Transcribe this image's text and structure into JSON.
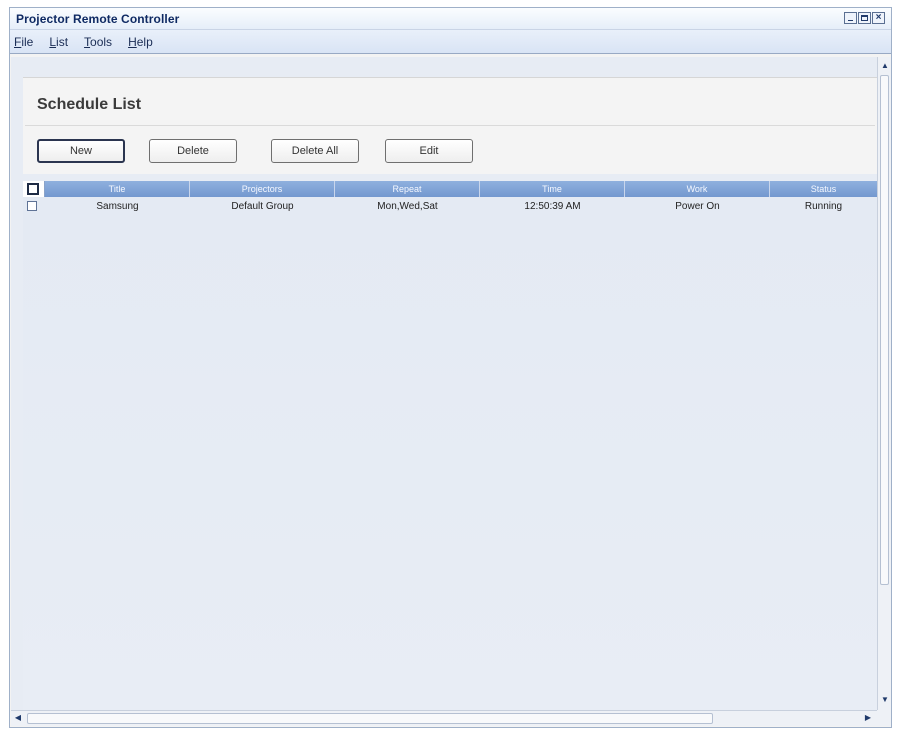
{
  "window": {
    "title": "Projector Remote Controller"
  },
  "menu": [
    {
      "label": "File",
      "mnemonic": "F",
      "rest": "ile"
    },
    {
      "label": "List",
      "mnemonic": "L",
      "rest": "ist"
    },
    {
      "label": "Tools",
      "mnemonic": "T",
      "rest": "ools"
    },
    {
      "label": "Help",
      "mnemonic": "H",
      "rest": "elp"
    }
  ],
  "page": {
    "title": "Schedule List"
  },
  "toolbar": {
    "new_label": "New",
    "delete_label": "Delete",
    "delete_all_label": "Delete All",
    "edit_label": "Edit"
  },
  "table": {
    "columns": [
      "Title",
      "Projectors",
      "Repeat",
      "Time",
      "Work",
      "Status"
    ],
    "rows": [
      {
        "checked": false,
        "cells": [
          "Samsung",
          "Default Group",
          "Mon,Wed,Sat",
          "12:50:39 AM",
          "Power On",
          "Running"
        ]
      }
    ]
  },
  "colors": {
    "header_blue": "#7f9fd4",
    "title_text": "#0f2a63",
    "table_bg": "#e4eaf3"
  },
  "icons": {
    "scroll_up": "▲",
    "scroll_down": "▼",
    "scroll_left": "◀",
    "scroll_right": "▶",
    "close": "×"
  }
}
